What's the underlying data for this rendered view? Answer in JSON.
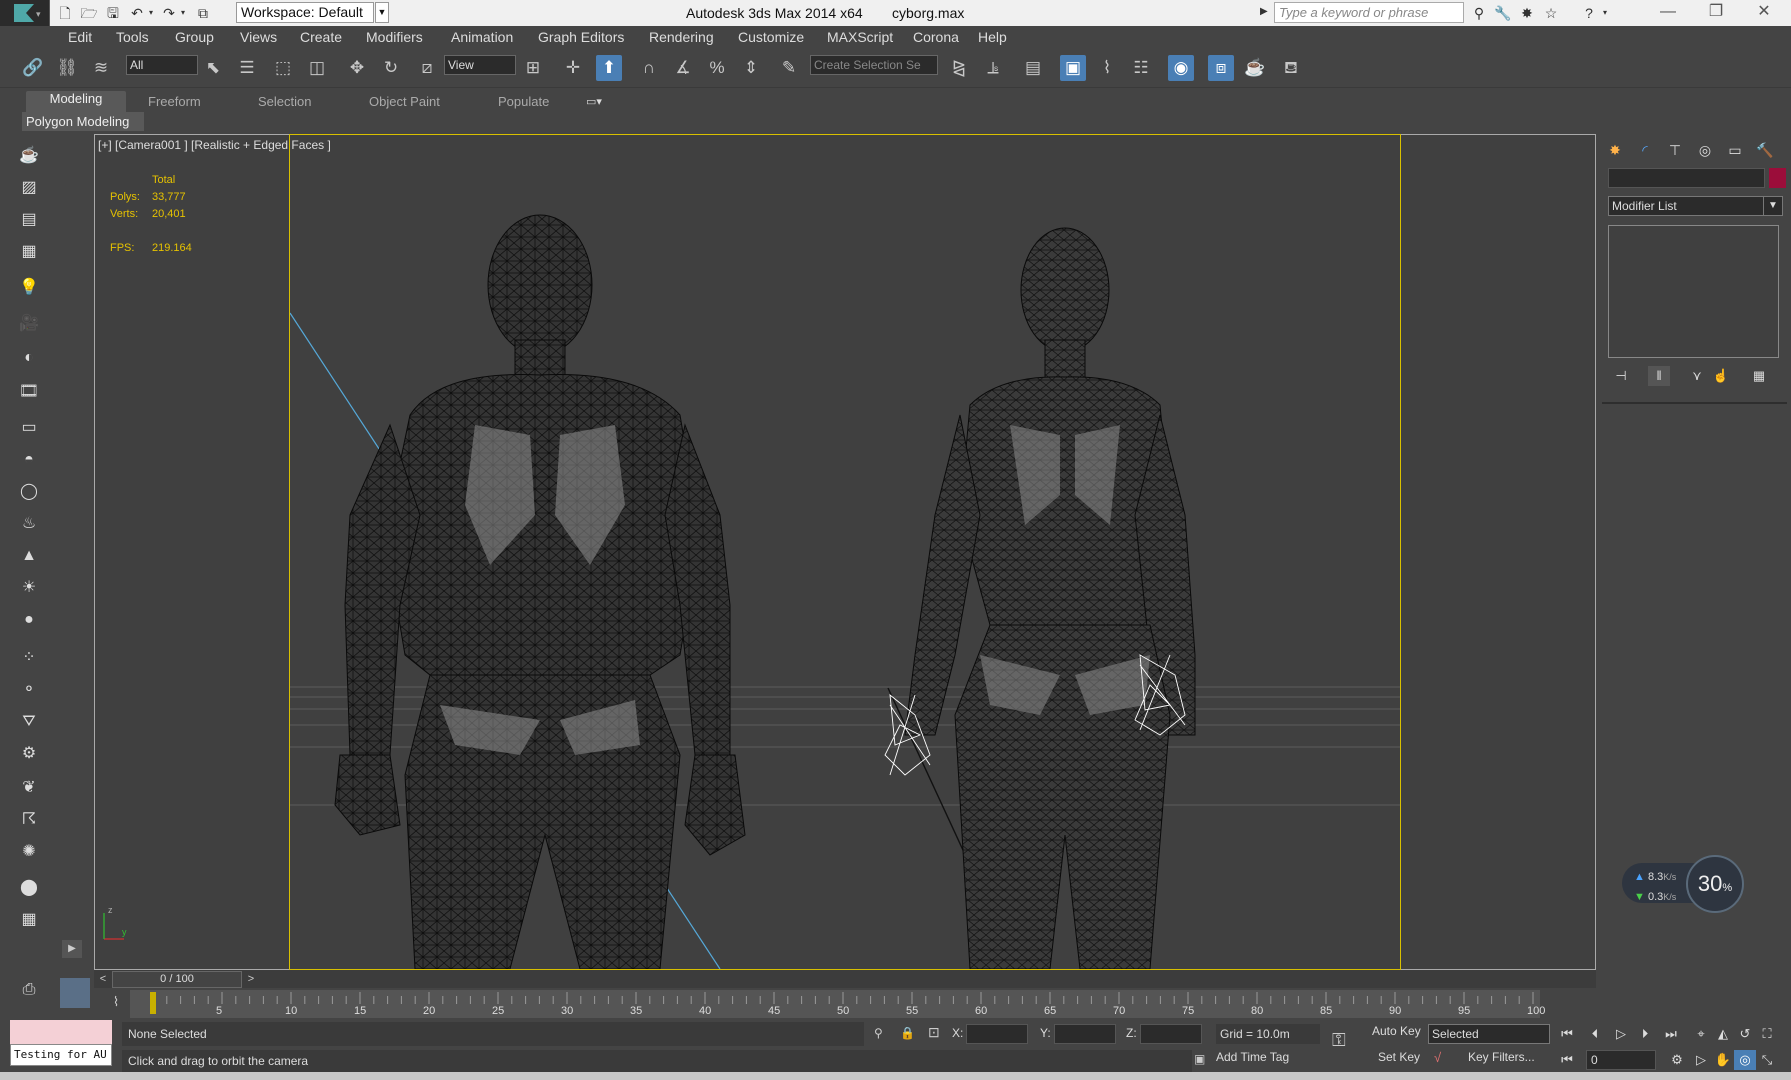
{
  "titlebar": {
    "workspace": "Workspace: Default",
    "app_title": "Autodesk 3ds Max  2014 x64",
    "file_name": "cyborg.max",
    "search_placeholder": "Type a keyword or phrase"
  },
  "menu": [
    "Edit",
    "Tools",
    "Group",
    "Views",
    "Create",
    "Modifiers",
    "Animation",
    "Graph Editors",
    "Rendering",
    "Customize",
    "MAXScript",
    "Corona",
    "Help"
  ],
  "toolbar": {
    "selection_filter": "All",
    "ref_coord": "View",
    "named_selection": "Create Selection Se"
  },
  "ribbon": {
    "tabs": [
      "Modeling",
      "Freeform",
      "Selection",
      "Object Paint",
      "Populate"
    ],
    "active_tab": "Modeling",
    "panel_label": "Polygon Modeling"
  },
  "viewport": {
    "label": "[+] [Camera001 ] [Realistic + Edged Faces ]",
    "stats_header": "Total",
    "polys_label": "Polys:",
    "polys_value": "33,777",
    "verts_label": "Verts:",
    "verts_value": "20,401",
    "fps_label": "FPS:",
    "fps_value": "219.164"
  },
  "command_panel": {
    "modifier_list": "Modifier List",
    "object_color": "#9b0d3a"
  },
  "net_monitor": {
    "up": "8.3",
    "down": "0.3",
    "unit": "K/s",
    "cpu_percent": "30",
    "cpu_suffix": "%"
  },
  "time_slider": {
    "position": "0 / 100",
    "ticks": [
      "5",
      "10",
      "15",
      "20",
      "25",
      "30",
      "35",
      "40",
      "45",
      "50",
      "55",
      "60",
      "65",
      "70",
      "75",
      "80",
      "85",
      "90",
      "95",
      "100"
    ]
  },
  "status": {
    "maxscript_text": "Testing for AU",
    "selection": "None Selected",
    "prompt": "Click and drag to orbit the camera",
    "x_label": "X:",
    "y_label": "Y:",
    "z_label": "Z:",
    "grid": "Grid = 10.0m",
    "add_time_tag": "Add Time Tag",
    "auto_key": "Auto Key",
    "set_key": "Set Key",
    "key_mode": "Selected",
    "key_filters": "Key Filters...",
    "frame": "0"
  }
}
